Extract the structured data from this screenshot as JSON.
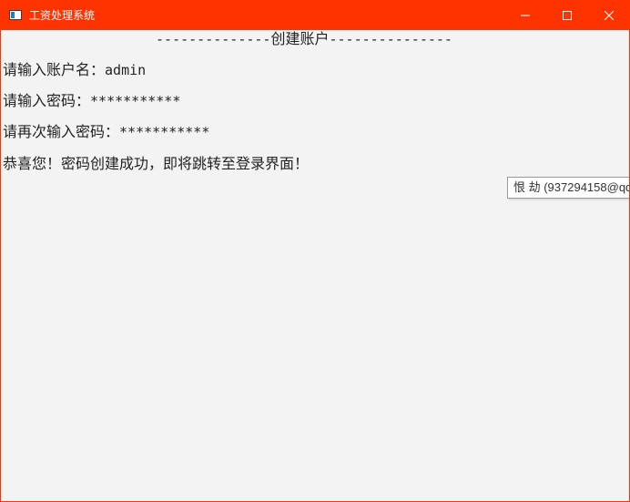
{
  "window": {
    "title": "工资处理系统",
    "accent_color": "#ff3300",
    "icons": {
      "app": "app-window-icon",
      "minimize": "minimize-icon",
      "maximize": "maximize-icon",
      "close": "close-icon"
    }
  },
  "console": {
    "header_dashes_left": "--------------",
    "header_title": "创建账户",
    "header_dashes_right": "---------------",
    "lines": [
      {
        "prompt": "请输入账户名：",
        "value": "admin"
      },
      {
        "prompt": "请输入密码：",
        "value": "***********"
      },
      {
        "prompt": "请再次输入密码：",
        "value": "***********"
      }
    ],
    "message": "恭喜您！密码创建成功，即将跳转至登录界面！"
  },
  "tooltip": {
    "text": "恨 劫 (937294158@qq"
  }
}
